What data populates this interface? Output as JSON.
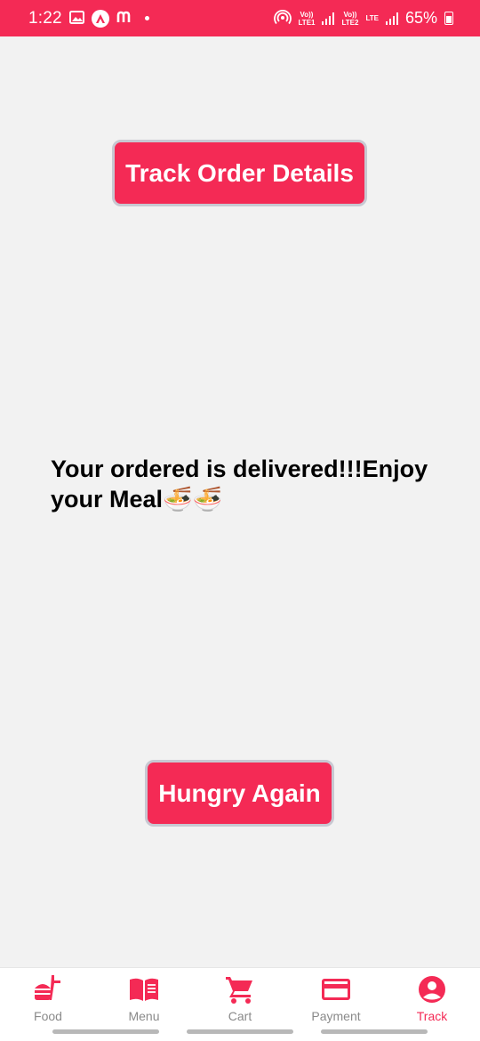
{
  "status_bar": {
    "time": "1:22",
    "network_tag_1": "Vo))\nLTE1",
    "network_tag_2": "Vo))\nLTE2",
    "lte_tag": "LTE",
    "battery": "65%"
  },
  "main": {
    "track_button_label": "Track Order Details",
    "message": "Your ordered is delivered!!!Enjoy your Meal🍜🍜",
    "hungry_button_label": "Hungry Again"
  },
  "bottom_nav": {
    "items": [
      {
        "label": "Food",
        "icon": "food-icon",
        "active": false
      },
      {
        "label": "Menu",
        "icon": "menu-book-icon",
        "active": false
      },
      {
        "label": "Cart",
        "icon": "cart-icon",
        "active": false
      },
      {
        "label": "Payment",
        "icon": "credit-card-icon",
        "active": false
      },
      {
        "label": "Track",
        "icon": "account-circle-icon",
        "active": true
      }
    ]
  },
  "colors": {
    "accent": "#f42a55",
    "background": "#f2f2f2",
    "inactive_label": "#8a8a8a"
  }
}
